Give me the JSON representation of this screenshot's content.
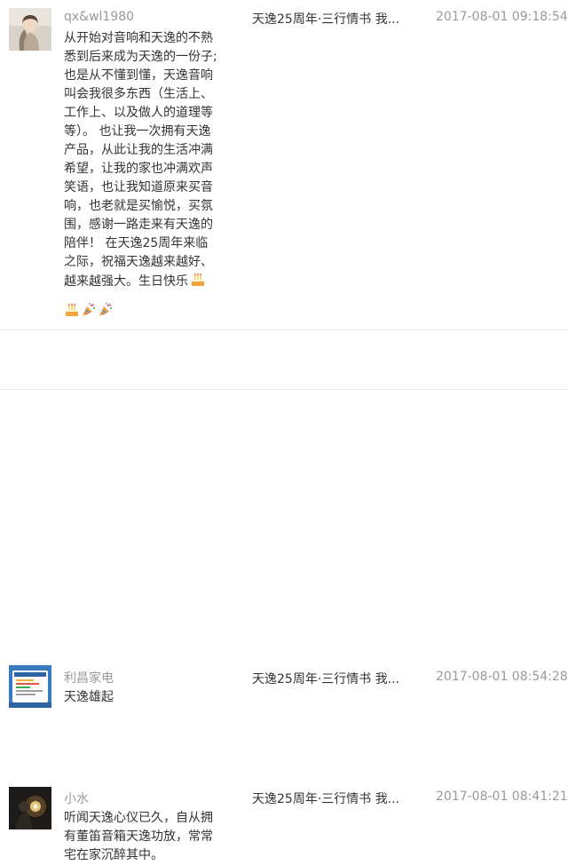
{
  "comments": [
    {
      "user": "qx&wl1980",
      "article": "天逸25周年·三行情书 我...",
      "time": "2017-08-01 09:18:54",
      "content": "从开始对音响和天逸的不熟\n悉到后来成为天逸的一份子;\n也是从不懂到懂，天逸音响\n叫会我很多东西（生活上、\n工作上、以及做人的道理等\n等）。 也让我一次拥有天逸\n产品，从此让我的生活冲满\n希望，让我的家也冲满欢声\n笑语，也让我知道原来买音\n响，也老就是买愉悦，买氛\n围，感谢一路走来有天逸的\n陪伴！ 在天逸25周年来临\n之际，祝福天逸越来越好、\n越来越强大。生日快乐"
    },
    {
      "user": "利昌家电",
      "article": "天逸25周年·三行情书 我...",
      "time": "2017-08-01 08:54:28",
      "content": "天逸雄起"
    },
    {
      "user": "小水",
      "article": "天逸25周年·三行情书 我...",
      "time": "2017-08-01 08:41:21",
      "content": "听闻天逸心仪已久，自从拥\n有董笛音箱天逸功放，常常\n宅在家沉醉其中。"
    }
  ],
  "icons": {
    "row1_inline": "cake-emoji",
    "row1_trailing": [
      "cake-emoji",
      "party-popper-emoji",
      "party-popper-emoji"
    ]
  }
}
